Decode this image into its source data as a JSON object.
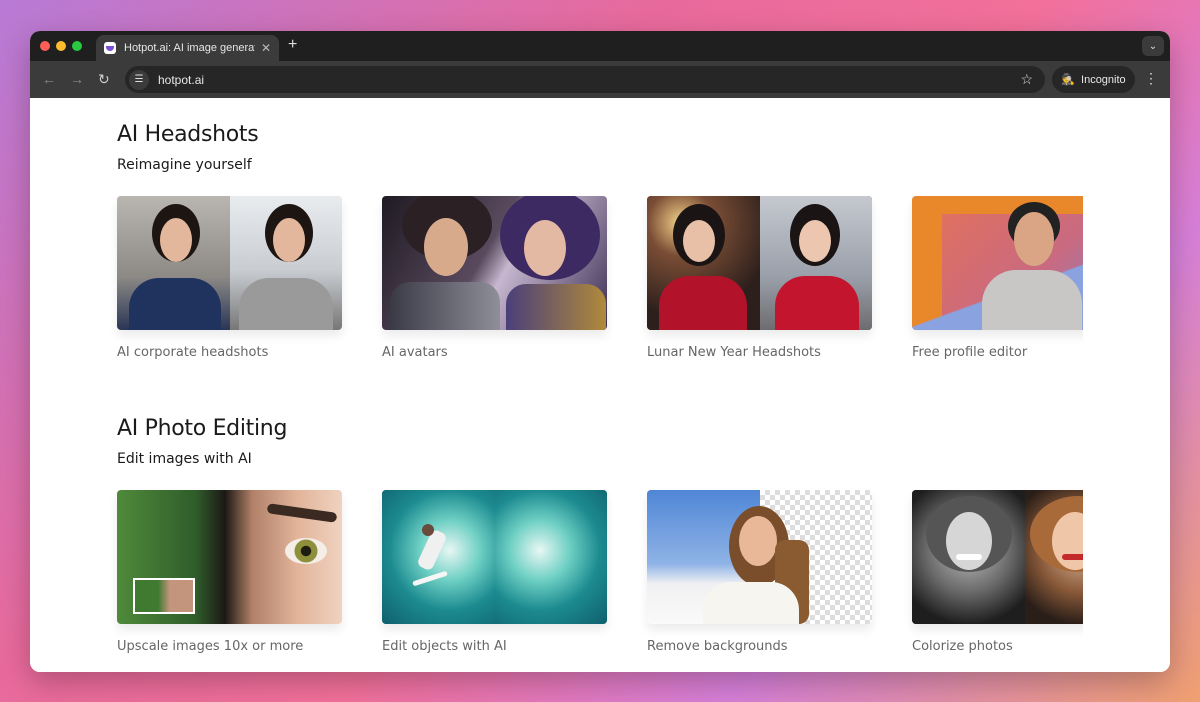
{
  "browser": {
    "tab_title": "Hotpot.ai: AI image generator",
    "url": "hotpot.ai",
    "incognito_label": "Incognito",
    "new_tab_glyph": "+",
    "close_glyph": "✕"
  },
  "sections": [
    {
      "title": "AI Headshots",
      "subtitle": "Reimagine yourself",
      "cards": [
        {
          "label": "AI corporate headshots"
        },
        {
          "label": "AI avatars"
        },
        {
          "label": "Lunar New Year Headshots"
        },
        {
          "label": "Free profile editor"
        }
      ]
    },
    {
      "title": "AI Photo Editing",
      "subtitle": "Edit images with AI",
      "cards": [
        {
          "label": "Upscale images 10x or more"
        },
        {
          "label": "Edit objects with AI"
        },
        {
          "label": "Remove backgrounds"
        },
        {
          "label": "Colorize photos"
        }
      ]
    }
  ],
  "colors": {
    "accent": "#7b4fd6",
    "browser_chrome": "#3b3b3b"
  },
  "icons": [
    "back-arrow-icon",
    "forward-arrow-icon",
    "reload-icon",
    "site-info-icon",
    "bookmark-star-icon",
    "incognito-icon",
    "menu-kebab-icon",
    "tab-list-chevron-icon"
  ]
}
